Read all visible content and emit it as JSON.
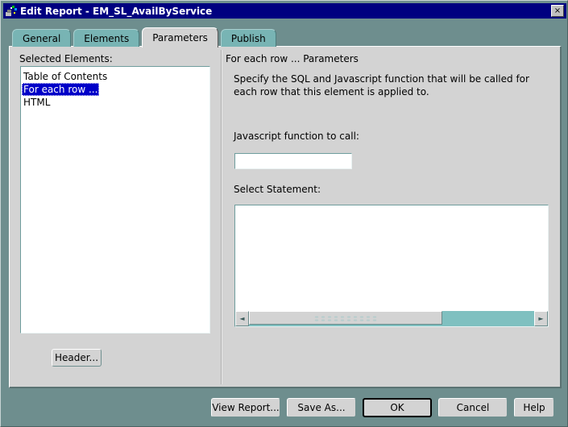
{
  "window": {
    "title": "Edit Report - EM_SL_AvailByService",
    "icon": "report-app-icon",
    "close_label": "×",
    "colors": {
      "titlebar": "#000080",
      "desktop": "#6e8e8e",
      "panel": "#d3d3d3",
      "tab_inactive": "#78b4b4",
      "tab_active": "#d3d3d3",
      "selection": "#0000c8",
      "scroll_track": "#7fc0c0"
    }
  },
  "tabs": [
    {
      "label": "General",
      "active": false
    },
    {
      "label": "Elements",
      "active": false
    },
    {
      "label": "Parameters",
      "active": true
    },
    {
      "label": "Publish",
      "active": false
    }
  ],
  "left_panel": {
    "label": "Selected Elements:",
    "items": [
      {
        "label": "Table of Contents",
        "selected": false
      },
      {
        "label": "For each row ...",
        "selected": true
      },
      {
        "label": "HTML",
        "selected": false
      }
    ],
    "header_button": "Header..."
  },
  "right_panel": {
    "title": "For each row ... Parameters",
    "description": "Specify the SQL and Javascript function that will be called for each row that this element is applied to.",
    "js_function": {
      "label": "Javascript function to call:",
      "value": "",
      "placeholder": ""
    },
    "select_statement": {
      "label": "Select Statement:",
      "value": "",
      "placeholder": ""
    },
    "scrollbar": {
      "left_arrow": "◄",
      "right_arrow": "►"
    }
  },
  "footer": {
    "buttons": [
      {
        "label": "View Report...",
        "default": false
      },
      {
        "label": "Save As...",
        "default": false
      },
      {
        "label": "OK",
        "default": true
      },
      {
        "label": "Cancel",
        "default": false
      },
      {
        "label": "Help",
        "default": false
      }
    ]
  }
}
